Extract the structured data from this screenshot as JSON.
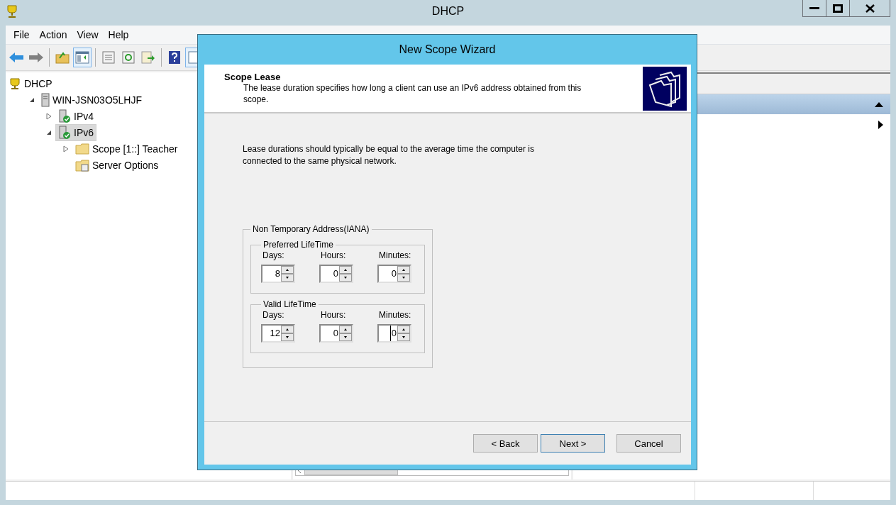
{
  "window": {
    "title": "DHCP"
  },
  "menu": [
    {
      "label": "File"
    },
    {
      "label": "Action"
    },
    {
      "label": "View"
    },
    {
      "label": "Help"
    }
  ],
  "toolbar_groups": [
    [
      {
        "kind": "back",
        "pressed": false
      },
      {
        "kind": "forward",
        "pressed": false
      }
    ],
    [
      {
        "kind": "up",
        "pressed": false
      },
      {
        "kind": "tree",
        "pressed": true
      }
    ],
    [
      {
        "kind": "props",
        "pressed": false
      },
      {
        "kind": "refresh",
        "pressed": false
      },
      {
        "kind": "export",
        "pressed": false
      }
    ],
    [
      {
        "kind": "help",
        "pressed": false
      },
      {
        "kind": "pane",
        "pressed": true
      }
    ]
  ],
  "tree": [
    {
      "label": "DHCP",
      "kind": "dhcp",
      "selected": false,
      "children": [
        {
          "label": "WIN-JSN03O5LHJF",
          "kind": "server",
          "selected": false,
          "expanded": true,
          "children": [
            {
              "label": "IPv4",
              "kind": "proto",
              "selected": false,
              "expanded": false
            },
            {
              "label": "IPv6",
              "kind": "proto",
              "selected": true,
              "expanded": true,
              "children": [
                {
                  "label": "Scope [1::] Teacher",
                  "kind": "folder",
                  "selected": false,
                  "expanded": false
                },
                {
                  "label": "Server Options",
                  "kind": "options",
                  "selected": false
                }
              ]
            }
          ]
        }
      ]
    }
  ],
  "wizard": {
    "title": "New Scope Wizard",
    "heading": "Scope Lease",
    "subheading": "The lease duration specifies how long a client can use an IPv6 address obtained from this scope.",
    "body": "Lease durations should typically be equal to the average time the computer is connected to the same physical network.",
    "group": {
      "title": "Non Temporary Address(IANA)",
      "subgroups": [
        {
          "title": "Preferred LifeTime",
          "fields": [
            {
              "label": "Days:",
              "value": "8",
              "focused": false
            },
            {
              "label": "Hours:",
              "value": "0",
              "focused": false
            },
            {
              "label": "Minutes:",
              "value": "0",
              "focused": false
            }
          ]
        },
        {
          "title": "Valid LifeTime",
          "fields": [
            {
              "label": "Days:",
              "value": "12",
              "focused": false
            },
            {
              "label": "Hours:",
              "value": "0",
              "focused": false
            },
            {
              "label": "Minutes:",
              "value": "0",
              "focused": true
            }
          ]
        }
      ]
    },
    "buttons": [
      {
        "label": "< Back",
        "default": false
      },
      {
        "label": "Next >",
        "default": true
      },
      {
        "label": "Cancel",
        "default": false
      }
    ]
  }
}
